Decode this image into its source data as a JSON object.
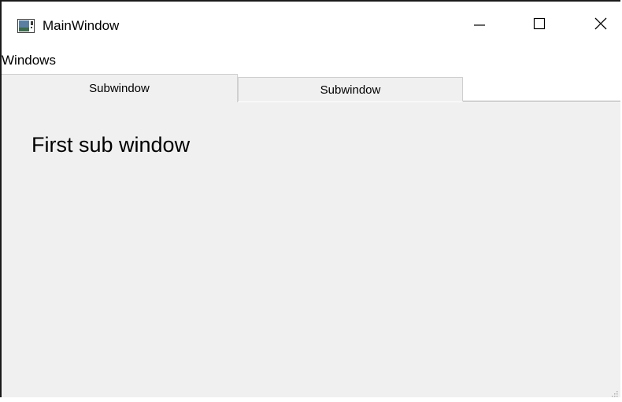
{
  "window": {
    "title": "MainWindow",
    "icon": "app-window-icon",
    "controls": {
      "minimize": "minimize-icon",
      "maximize": "maximize-icon",
      "close": "close-icon"
    }
  },
  "menubar": {
    "items": [
      {
        "label": "Windows"
      }
    ]
  },
  "tabs": [
    {
      "label": "Subwindow",
      "active": true
    },
    {
      "label": "Subwindow",
      "active": false
    }
  ],
  "content": {
    "label": "First sub window"
  },
  "colors": {
    "content_background": "#f0f0f0",
    "window_border": "#1a1a1a",
    "tab_border": "#cfcfcf"
  }
}
